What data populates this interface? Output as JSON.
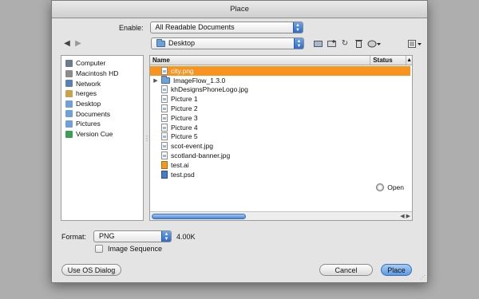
{
  "window": {
    "title": "Place"
  },
  "enable": {
    "label": "Enable:",
    "value": "All Readable Documents"
  },
  "location": {
    "value": "Desktop"
  },
  "sidebar": {
    "items": [
      {
        "label": "Computer",
        "icon": "computer-icon",
        "color": "#6c7a8c"
      },
      {
        "label": "Macintosh HD",
        "icon": "hard-drive-icon",
        "color": "#8b8b8b"
      },
      {
        "label": "Network",
        "icon": "network-icon",
        "color": "#5a7fb6"
      },
      {
        "label": "herges",
        "icon": "home-icon",
        "color": "#c9a24b"
      },
      {
        "label": "Desktop",
        "icon": "desktop-folder-icon",
        "color": "#6fa0d8"
      },
      {
        "label": "Documents",
        "icon": "documents-folder-icon",
        "color": "#6fa0d8"
      },
      {
        "label": "Pictures",
        "icon": "pictures-folder-icon",
        "color": "#6fa0d8"
      },
      {
        "label": "Version Cue",
        "icon": "version-cue-icon",
        "color": "#3b9f5a"
      }
    ]
  },
  "filelist": {
    "columns": {
      "name": "Name",
      "status": "Status",
      "sort": "▲"
    },
    "items": [
      {
        "name": "city.png",
        "type": "image",
        "selected": true
      },
      {
        "name": "ImageFlow_1.3.0",
        "type": "folder"
      },
      {
        "name": "khDesignsPhoneLogo.jpg",
        "type": "image"
      },
      {
        "name": "Picture 1",
        "type": "image"
      },
      {
        "name": "Picture 2",
        "type": "image"
      },
      {
        "name": "Picture 3",
        "type": "image"
      },
      {
        "name": "Picture 4",
        "type": "image"
      },
      {
        "name": "Picture 5",
        "type": "image"
      },
      {
        "name": "scot-event.jpg",
        "type": "image"
      },
      {
        "name": "scotland-banner.jpg",
        "type": "image"
      },
      {
        "name": "test.ai",
        "type": "ai"
      },
      {
        "name": "test.psd",
        "type": "psd"
      }
    ],
    "open_label": "Open"
  },
  "format": {
    "label": "Format:",
    "value": "PNG",
    "size": "4.00K"
  },
  "image_sequence": {
    "label": "Image Sequence"
  },
  "buttons": {
    "os_dialog": "Use OS Dialog",
    "cancel": "Cancel",
    "place": "Place"
  },
  "colors": {
    "selection": "#f7931e",
    "accent": "#5b9ae3"
  }
}
